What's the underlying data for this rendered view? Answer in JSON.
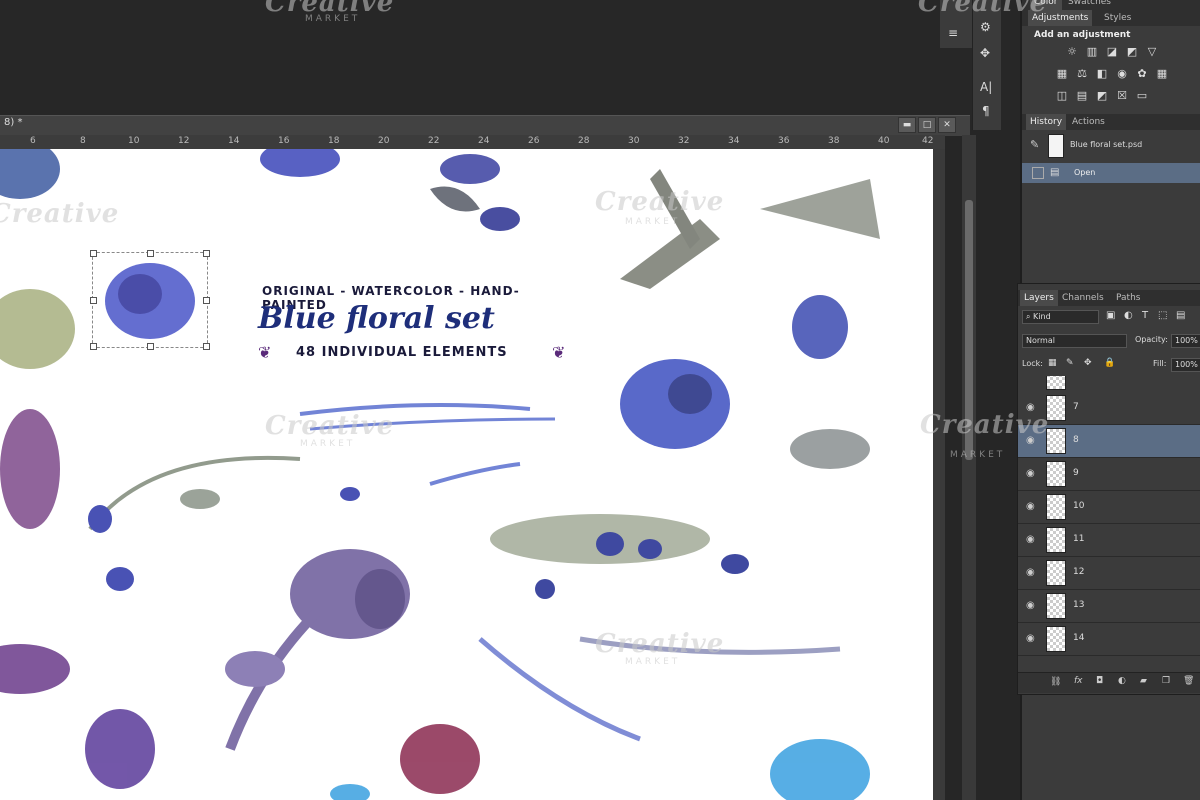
{
  "document": {
    "title": "8) *",
    "ruler_ticks": [
      "6",
      "8",
      "10",
      "12",
      "14",
      "16",
      "18",
      "20",
      "22",
      "24",
      "26",
      "28",
      "30",
      "32",
      "34",
      "36",
      "38",
      "40",
      "42"
    ]
  },
  "canvas": {
    "title_sub": "ORIGINAL - WATERCOLOR - HAND-PAINTED",
    "title_main": "Blue floral set",
    "title_count": "48 INDIVIDUAL ELEMENTS",
    "watermark": "Creative",
    "watermark_sub": "MARKET"
  },
  "right_panel": {
    "color_tabs": [
      "Color",
      "Swatches"
    ],
    "adjustments_tabs": [
      "Adjustments",
      "Styles"
    ],
    "adjustments_heading": "Add an adjustment",
    "history_tabs": [
      "History",
      "Actions"
    ],
    "history_items": [
      "Blue floral set.psd",
      "Open"
    ],
    "layers_tabs": [
      "Layers",
      "Channels",
      "Paths"
    ],
    "kind_label": "Kind",
    "blend_mode": "Normal",
    "opacity_label": "Opacity:",
    "opacity_value": "100%",
    "lock_label": "Lock:",
    "fill_label": "Fill:",
    "fill_value": "100%",
    "layers": [
      "7",
      "8",
      "9",
      "10",
      "11",
      "12",
      "13",
      "14"
    ],
    "selected_layer": "8"
  },
  "colors": {
    "selection_highlight": "#5b6d85",
    "panel_bg": "#3b3b3b",
    "title_blue": "#1e2e7a"
  }
}
